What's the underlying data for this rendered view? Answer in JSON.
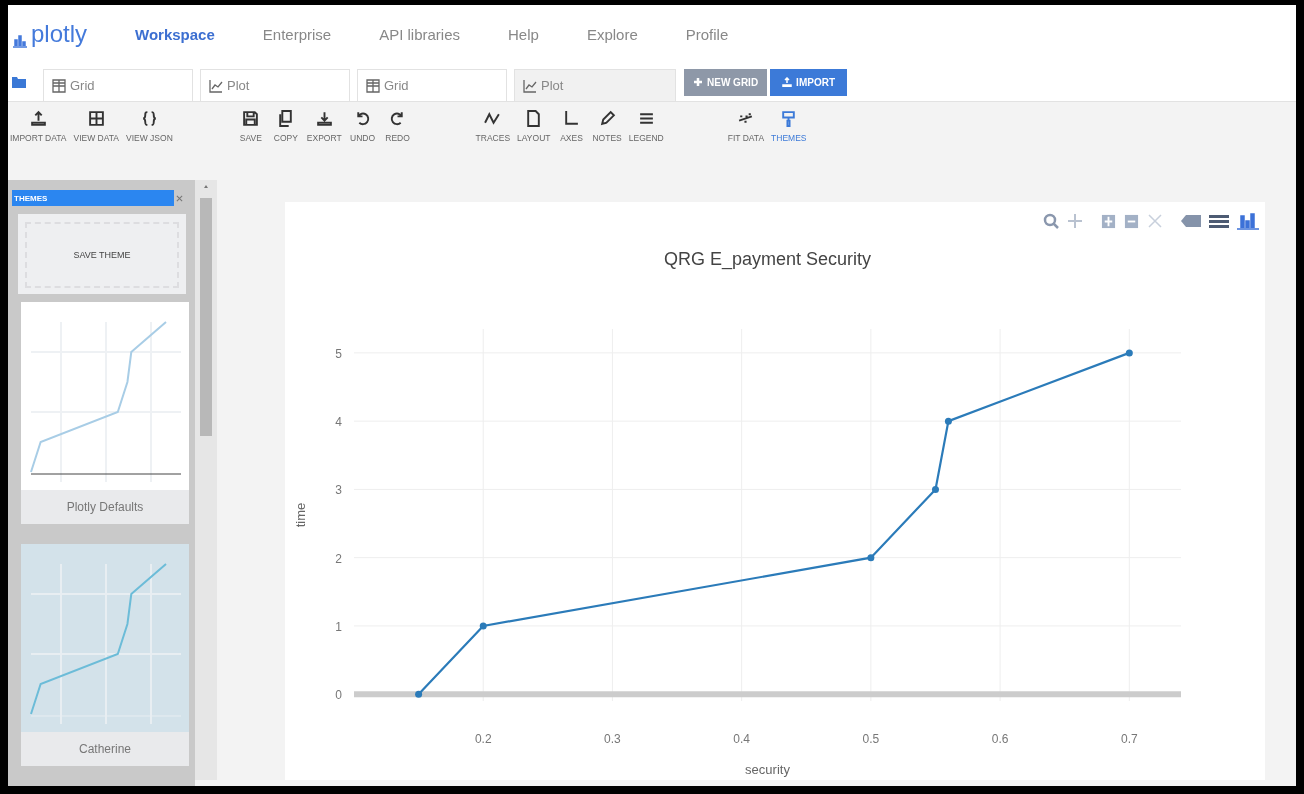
{
  "nav": {
    "logo": "plotly",
    "links": [
      {
        "label": "Workspace",
        "selected": true
      },
      {
        "label": "Enterprise",
        "selected": false
      },
      {
        "label": "API libraries",
        "selected": false
      },
      {
        "label": "Help",
        "selected": false
      },
      {
        "label": "Explore",
        "selected": false
      },
      {
        "label": "Profile",
        "selected": false
      }
    ]
  },
  "tabs": [
    {
      "kind": "grid",
      "label": "Grid",
      "selected": false
    },
    {
      "kind": "plot",
      "label": "Plot",
      "selected": false
    },
    {
      "kind": "grid",
      "label": "Grid",
      "selected": false
    },
    {
      "kind": "plot",
      "label": "Plot",
      "selected": true
    }
  ],
  "tab_buttons": [
    {
      "kind": "new",
      "label": "NEW GRID"
    },
    {
      "kind": "import",
      "label": "IMPORT"
    }
  ],
  "toolbar": [
    [
      {
        "label": "IMPORT DATA",
        "selected": false
      },
      {
        "label": "VIEW DATA",
        "selected": false
      },
      {
        "label": "VIEW JSON",
        "selected": false
      }
    ],
    [
      {
        "label": "SAVE",
        "selected": false
      },
      {
        "label": "COPY",
        "selected": false
      },
      {
        "label": "EXPORT",
        "selected": false
      },
      {
        "label": "UNDO",
        "selected": false
      },
      {
        "label": "REDO",
        "selected": false
      }
    ],
    [
      {
        "label": "TRACES",
        "selected": false
      },
      {
        "label": "LAYOUT",
        "selected": false
      },
      {
        "label": "AXES",
        "selected": false
      },
      {
        "label": "NOTES",
        "selected": false
      },
      {
        "label": "LEGEND",
        "selected": false
      }
    ],
    [
      {
        "label": "FIT DATA",
        "selected": false
      },
      {
        "label": "THEMES",
        "selected": true
      }
    ]
  ],
  "sidebar": {
    "search": {
      "value": "THEMES"
    },
    "save_theme": "SAVE THEME",
    "themes": [
      {
        "name": "Plotly Defaults"
      },
      {
        "name": "Catherine"
      }
    ]
  },
  "chart_data": {
    "type": "line",
    "title": "QRG E_payment Security",
    "xlabel": "security",
    "ylabel": "time",
    "x": [
      0.15,
      0.2,
      0.5,
      0.55,
      0.56,
      0.7
    ],
    "grid": true,
    "series": [
      {
        "color": "#2b7bb9",
        "marker": true,
        "values": [
          0,
          1,
          2,
          3,
          4,
          5
        ]
      }
    ],
    "xlim": [
      0.1,
      0.74
    ],
    "ylim": [
      -0.1,
      5.35
    ],
    "xticks": [
      0.2,
      0.3,
      0.4,
      0.5,
      0.6,
      0.7
    ],
    "yticks": [
      0,
      1,
      2,
      3,
      4,
      5
    ]
  }
}
